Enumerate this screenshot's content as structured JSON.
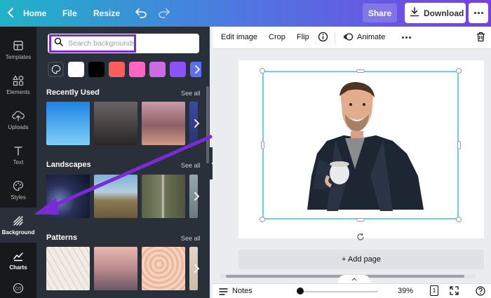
{
  "topbar": {
    "home_label": "Home",
    "file_label": "File",
    "resize_label": "Resize",
    "share_label": "Share",
    "download_label": "Download",
    "colors": {
      "gradient_start": "#1fb3c7",
      "gradient_end": "#7a3fe4"
    }
  },
  "rail": {
    "items": [
      {
        "label": "Templates",
        "icon": "templates-icon"
      },
      {
        "label": "Elements",
        "icon": "elements-icon"
      },
      {
        "label": "Uploads",
        "icon": "upload-cloud-icon"
      },
      {
        "label": "Text",
        "icon": "text-icon"
      },
      {
        "label": "Styles",
        "icon": "palette-icon"
      },
      {
        "label": "Background",
        "icon": "background-hatch-icon",
        "active": true
      },
      {
        "label": "Charts",
        "icon": "chart-icon"
      }
    ]
  },
  "panel": {
    "search_placeholder": "Search backgrounds",
    "color_swatches": [
      "#ffffff",
      "#000000",
      "#ff5c5c",
      "#ff66c4",
      "#cb6ce6",
      "#8c52ff",
      "#5e6ef0"
    ],
    "sections": [
      {
        "title": "Recently Used",
        "see_all": "See all"
      },
      {
        "title": "Landscapes",
        "see_all": "See all"
      },
      {
        "title": "Patterns",
        "see_all": "See all"
      }
    ]
  },
  "toolbar": {
    "edit_image": "Edit image",
    "crop": "Crop",
    "flip": "Flip",
    "animate": "Animate"
  },
  "canvas": {
    "add_page": "+ Add page"
  },
  "bottombar": {
    "notes": "Notes",
    "zoom": "39%",
    "page_count": "1",
    "zoom_fraction": 0.0
  }
}
